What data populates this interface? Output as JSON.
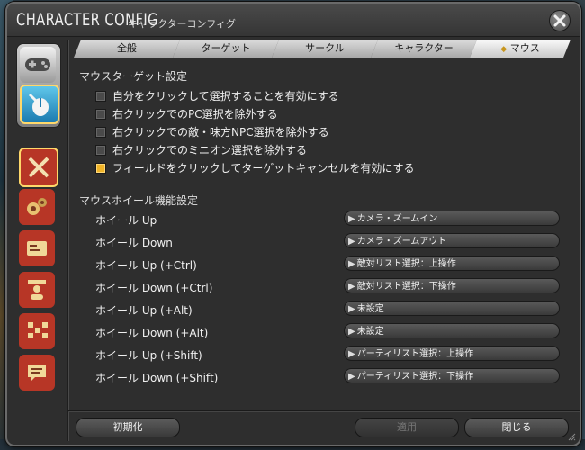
{
  "window": {
    "title": "CHARACTER CONFIG",
    "subtitle": "キャラクターコンフィグ"
  },
  "tabs": [
    {
      "label": "全般",
      "active": false
    },
    {
      "label": "ターゲット",
      "active": false
    },
    {
      "label": "サークル",
      "active": false
    },
    {
      "label": "キャラクター",
      "active": false
    },
    {
      "label": "マウス",
      "active": true
    }
  ],
  "sidebar": {
    "top_icons": [
      "gamepad-icon",
      "mouse-icon"
    ],
    "category_icons": [
      "crossed-swords-icon",
      "gears-icon",
      "card-icon",
      "person-icon",
      "checker-icon",
      "chat-icon"
    ]
  },
  "mouse_target": {
    "heading": "マウスターゲット設定",
    "options": [
      {
        "label": "自分をクリックして選択することを有効にする",
        "checked": false
      },
      {
        "label": "右クリックでのPC選択を除外する",
        "checked": false
      },
      {
        "label": "右クリックでの敵・味方NPC選択を除外する",
        "checked": false
      },
      {
        "label": "右クリックでのミニオン選択を除外する",
        "checked": false
      },
      {
        "label": "フィールドをクリックしてターゲットキャンセルを有効にする",
        "checked": true
      }
    ]
  },
  "mouse_wheel": {
    "heading": "マウスホイール機能設定",
    "rows": [
      {
        "label": "ホイール Up",
        "value": "カメラ・ズームイン"
      },
      {
        "label": "ホイール Down",
        "value": "カメラ・ズームアウト"
      },
      {
        "label": "ホイール Up (+Ctrl)",
        "value": "敵対リスト選択：上操作"
      },
      {
        "label": "ホイール Down (+Ctrl)",
        "value": "敵対リスト選択：下操作"
      },
      {
        "label": "ホイール Up (+Alt)",
        "value": "未設定"
      },
      {
        "label": "ホイール Down (+Alt)",
        "value": "未設定"
      },
      {
        "label": "ホイール Up (+Shift)",
        "value": "パーティリスト選択：上操作"
      },
      {
        "label": "ホイール Down (+Shift)",
        "value": "パーティリスト選択：下操作"
      }
    ]
  },
  "footer": {
    "reset_label": "初期化",
    "apply_label": "適用",
    "close_label": "閉じる"
  },
  "colors": {
    "checked": "#f0b428",
    "panel": "#2e2e2e",
    "tab_active": "#fafafa"
  }
}
